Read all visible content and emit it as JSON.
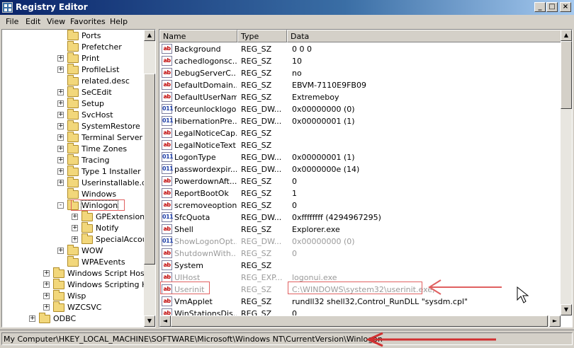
{
  "window": {
    "title": "Registry Editor",
    "min_glyph": "_",
    "max_glyph": "□",
    "close_glyph": "×"
  },
  "menu": [
    "File",
    "Edit",
    "View",
    "Favorites",
    "Help"
  ],
  "tree": [
    {
      "label": "Ports",
      "depth": 3,
      "expander": ""
    },
    {
      "label": "Prefetcher",
      "depth": 3,
      "expander": ""
    },
    {
      "label": "Print",
      "depth": 3,
      "expander": "+"
    },
    {
      "label": "ProfileList",
      "depth": 3,
      "expander": "+"
    },
    {
      "label": "related.desc",
      "depth": 3,
      "expander": ""
    },
    {
      "label": "SeCEdit",
      "depth": 3,
      "expander": "+"
    },
    {
      "label": "Setup",
      "depth": 3,
      "expander": "+"
    },
    {
      "label": "SvcHost",
      "depth": 3,
      "expander": "+"
    },
    {
      "label": "SystemRestore",
      "depth": 3,
      "expander": "+"
    },
    {
      "label": "Terminal Server",
      "depth": 3,
      "expander": "+"
    },
    {
      "label": "Time Zones",
      "depth": 3,
      "expander": "+"
    },
    {
      "label": "Tracing",
      "depth": 3,
      "expander": "+"
    },
    {
      "label": "Type 1 Installer",
      "depth": 3,
      "expander": "+"
    },
    {
      "label": "Userinstallable.d",
      "depth": 3,
      "expander": "+"
    },
    {
      "label": "Windows",
      "depth": 3,
      "expander": ""
    },
    {
      "label": "Winlogon",
      "depth": 3,
      "expander": "-",
      "selected": true
    },
    {
      "label": "GPExtension",
      "depth": 4,
      "expander": "+"
    },
    {
      "label": "Notify",
      "depth": 4,
      "expander": "+"
    },
    {
      "label": "SpecialAccou",
      "depth": 4,
      "expander": "+"
    },
    {
      "label": "WOW",
      "depth": 3,
      "expander": "+"
    },
    {
      "label": "WPAEvents",
      "depth": 3,
      "expander": ""
    },
    {
      "label": "Windows Script Host",
      "depth": 2,
      "expander": "+"
    },
    {
      "label": "Windows Scripting Host",
      "depth": 2,
      "expander": "+"
    },
    {
      "label": "Wisp",
      "depth": 2,
      "expander": "+"
    },
    {
      "label": "WZCSVC",
      "depth": 2,
      "expander": "+"
    },
    {
      "label": "ODBC",
      "depth": 1,
      "expander": "+"
    }
  ],
  "list": {
    "headers": [
      "Name",
      "Type",
      "Data"
    ],
    "rows": [
      {
        "icon": "ab",
        "kind": "sz",
        "name": "Background",
        "type": "REG_SZ",
        "data": "0 0 0"
      },
      {
        "icon": "ab",
        "kind": "sz",
        "name": "cachedlogonsc...",
        "type": "REG_SZ",
        "data": "10"
      },
      {
        "icon": "ab",
        "kind": "sz",
        "name": "DebugServerC...",
        "type": "REG_SZ",
        "data": "no"
      },
      {
        "icon": "ab",
        "kind": "sz",
        "name": "DefaultDomain...",
        "type": "REG_SZ",
        "data": "EBVM-7110E9FB09"
      },
      {
        "icon": "ab",
        "kind": "sz",
        "name": "DefaultUserName",
        "type": "REG_SZ",
        "data": "Extremeboy"
      },
      {
        "icon": "011",
        "kind": "bin",
        "name": "forceunlocklogon",
        "type": "REG_DW...",
        "data": "0x00000000 (0)"
      },
      {
        "icon": "011",
        "kind": "bin",
        "name": "HibernationPre...",
        "type": "REG_DW...",
        "data": "0x00000001 (1)"
      },
      {
        "icon": "ab",
        "kind": "sz",
        "name": "LegalNoticeCap...",
        "type": "REG_SZ",
        "data": ""
      },
      {
        "icon": "ab",
        "kind": "sz",
        "name": "LegalNoticeText",
        "type": "REG_SZ",
        "data": ""
      },
      {
        "icon": "011",
        "kind": "bin",
        "name": "LogonType",
        "type": "REG_DW...",
        "data": "0x00000001 (1)"
      },
      {
        "icon": "011",
        "kind": "bin",
        "name": "passwordexpir...",
        "type": "REG_DW...",
        "data": "0x0000000e (14)"
      },
      {
        "icon": "ab",
        "kind": "sz",
        "name": "PowerdownAft...",
        "type": "REG_SZ",
        "data": "0"
      },
      {
        "icon": "ab",
        "kind": "sz",
        "name": "ReportBootOk",
        "type": "REG_SZ",
        "data": "1"
      },
      {
        "icon": "ab",
        "kind": "sz",
        "name": "scremoveoption",
        "type": "REG_SZ",
        "data": "0"
      },
      {
        "icon": "011",
        "kind": "bin",
        "name": "SfcQuota",
        "type": "REG_DW...",
        "data": "0xffffffff (4294967295)"
      },
      {
        "icon": "ab",
        "kind": "sz",
        "name": "Shell",
        "type": "REG_SZ",
        "data": "Explorer.exe"
      },
      {
        "icon": "011",
        "kind": "bin",
        "name": "ShowLogonOpt...",
        "type": "REG_DW...",
        "data": "0x00000000 (0)",
        "faded": true
      },
      {
        "icon": "ab",
        "kind": "sz",
        "name": "ShutdownWith...",
        "type": "REG_SZ",
        "data": "0",
        "faded": true
      },
      {
        "icon": "ab",
        "kind": "sz",
        "name": "System",
        "type": "REG_SZ",
        "data": ""
      },
      {
        "icon": "ab",
        "kind": "sz",
        "name": "UIHost",
        "type": "REG_EXP...",
        "data": "logonui.exe",
        "faded": true
      },
      {
        "icon": "ab",
        "kind": "sz",
        "name": "Userinit",
        "type": "REG_SZ",
        "data": "C:\\WINDOWS\\system32\\userinit.exe,",
        "faded": true
      },
      {
        "icon": "ab",
        "kind": "sz",
        "name": "VmApplet",
        "type": "REG_SZ",
        "data": "rundll32 shell32,Control_RunDLL \"sysdm.cpl\""
      },
      {
        "icon": "ab",
        "kind": "sz",
        "name": "WinStationsDis...",
        "type": "REG_SZ",
        "data": "0"
      }
    ]
  },
  "status": {
    "path": "My Computer\\HKEY_LOCAL_MACHINE\\SOFTWARE\\Microsoft\\Windows NT\\CurrentVersion\\Winlogon"
  },
  "scroll_glyphs": {
    "up": "▲",
    "down": "▼",
    "left": "◄",
    "right": "►"
  },
  "colors": {
    "annotation": "#e06060",
    "title_start": "#0a246a",
    "title_end": "#a6caf0"
  }
}
